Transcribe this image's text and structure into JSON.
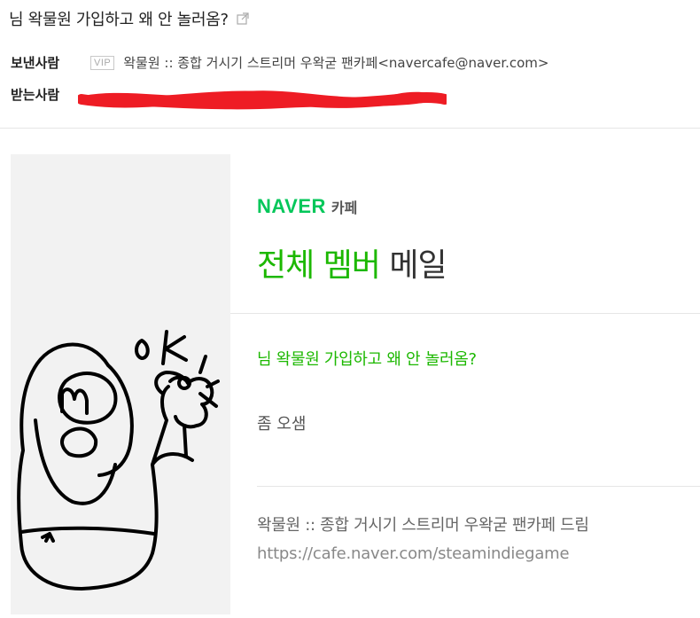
{
  "header": {
    "subject": "님 왁물원 가입하고 왜 안 놀러옴?",
    "sender_label": "보낸사람",
    "vip_badge": "VIP",
    "sender": "왁물원 :: 종합 거시기 스트리머 우왁굳 팬카페<navercafe@naver.com>",
    "recipient_label": "받는사람",
    "redaction_color": "#ee1c24"
  },
  "mail": {
    "brand_naver": "NAVER",
    "brand_cafe": "카페",
    "headline_green": "전체 멤버",
    "headline_gray": "메일",
    "post_title": "님 왁물원 가입하고 왜 안 놀러옴?",
    "post_body": "좀 오샘",
    "cafe_name": "왁물원 :: 종합 거시기 스트리머 우왁굳 팬카페 드림",
    "cafe_url": "https://cafe.naver.com/steamindiegame",
    "doodle_text": "oK"
  },
  "colors": {
    "naver_green": "#03c75a",
    "accent_green": "#1cb800",
    "art_bg": "#f2f2f2"
  }
}
